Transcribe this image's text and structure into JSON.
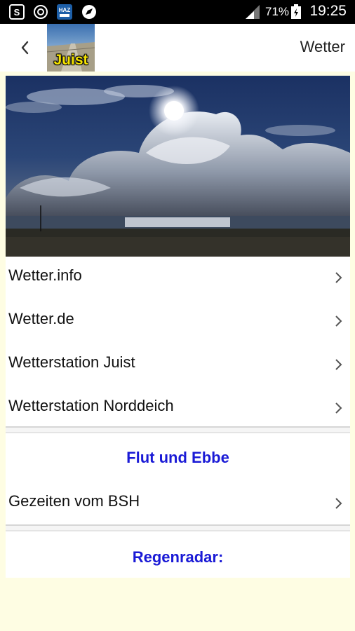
{
  "status_bar": {
    "battery_percent": "71%",
    "time": "19:25",
    "icons": [
      "screenshot-icon",
      "sync-icon",
      "haz-app-icon",
      "compass-icon",
      "signal-icon",
      "battery-icon"
    ],
    "haz_label": "HAZ"
  },
  "appbar": {
    "title": "Wetter",
    "logo_text": "Juist",
    "back_icon": "chevron-left-icon"
  },
  "menu_weather": [
    {
      "label": "Wetter.info"
    },
    {
      "label": "Wetter.de"
    },
    {
      "label": "Wetterstation Juist"
    },
    {
      "label": "Wetterstation Norddeich"
    }
  ],
  "tides": {
    "title": "Flut und Ebbe",
    "items": [
      {
        "label": "Gezeiten vom BSH"
      }
    ]
  },
  "radar": {
    "title": "Regenradar:"
  },
  "colors": {
    "background": "#fefde3",
    "section_title": "#1a1ad6",
    "logo_text": "#f6e400"
  }
}
